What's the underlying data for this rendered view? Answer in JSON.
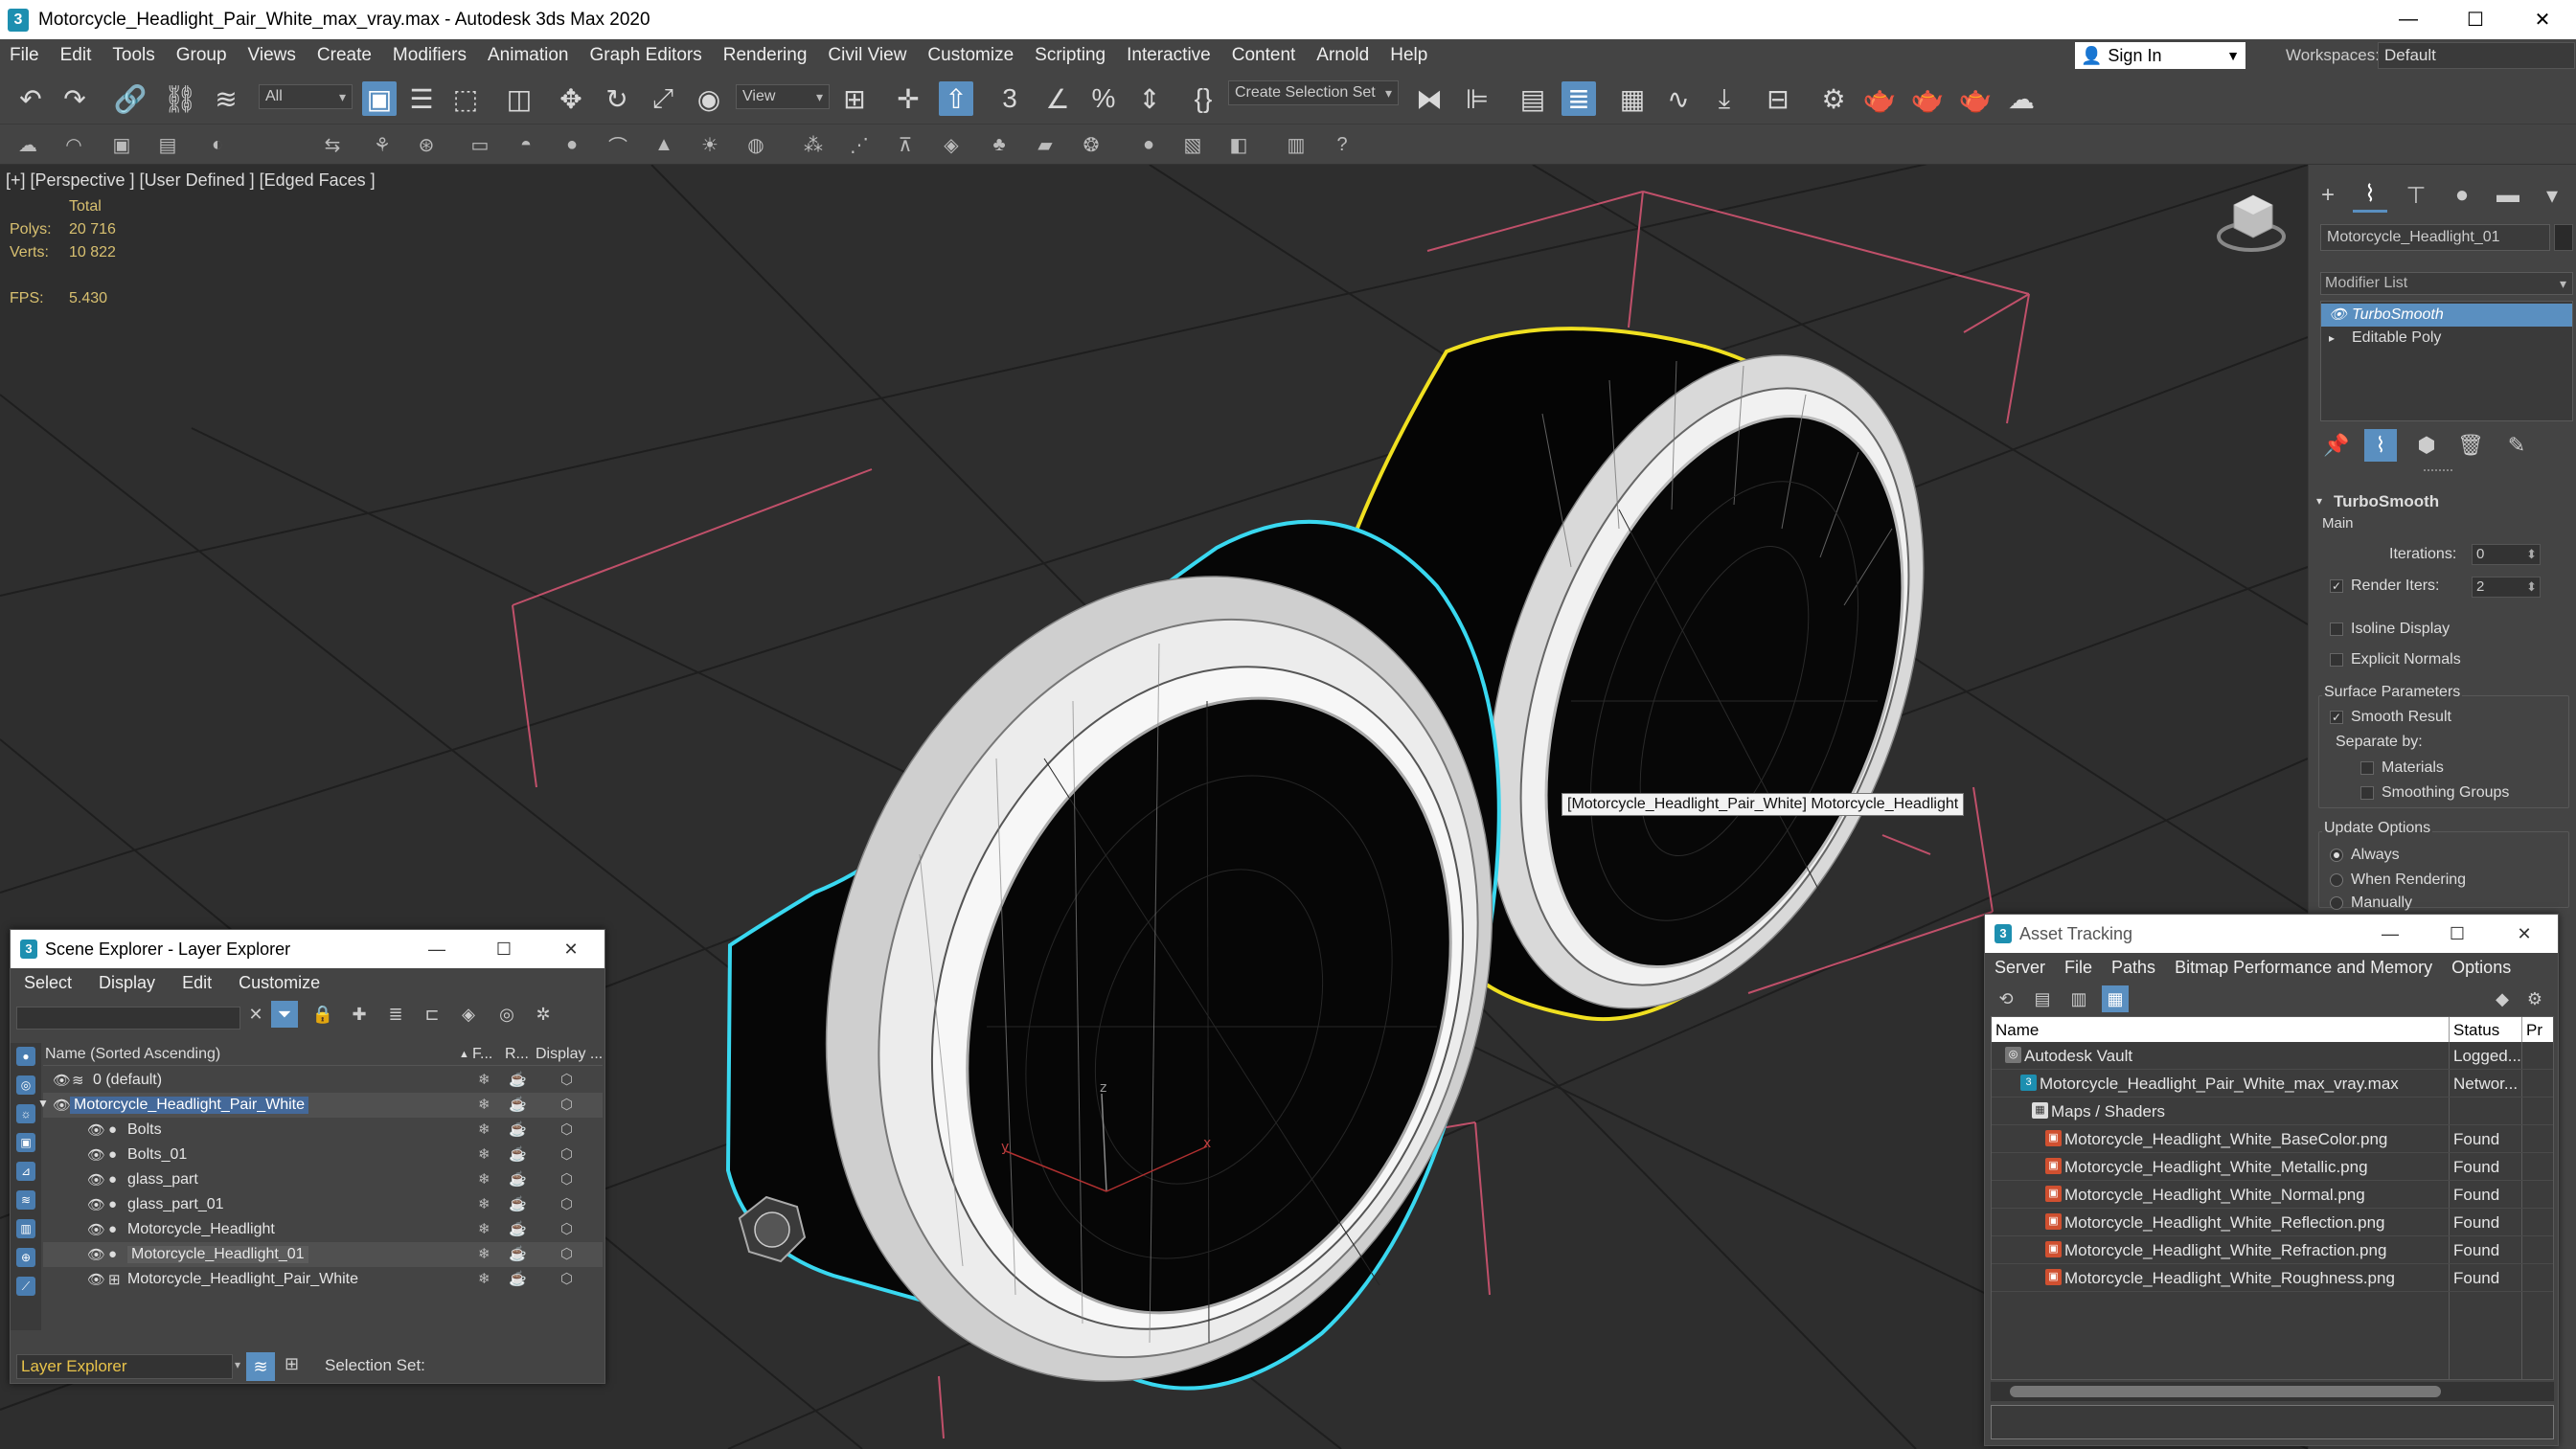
{
  "window": {
    "title": "Motorcycle_Headlight_Pair_White_max_vray.max - Autodesk 3ds Max 2020",
    "app_icon": "3",
    "minimize": "—",
    "maximize": "☐",
    "close": "✕"
  },
  "menu": [
    "File",
    "Edit",
    "Tools",
    "Group",
    "Views",
    "Create",
    "Modifiers",
    "Animation",
    "Graph Editors",
    "Rendering",
    "Civil View",
    "Customize",
    "Scripting",
    "Interactive",
    "Content",
    "Arnold",
    "Help"
  ],
  "signin": {
    "label": "Sign In",
    "icon": "user-icon"
  },
  "workspaces": {
    "label": "Workspaces:",
    "value": "Default"
  },
  "toolbar": {
    "selection_filter": "All",
    "reference_coord": "View",
    "selection_set": "Create Selection Set"
  },
  "viewport": {
    "label": "[+] [Perspective ] [User Defined ] [Edged Faces ]",
    "stats_header": "Total",
    "polys_label": "Polys:",
    "polys_value": "20 716",
    "verts_label": "Verts:",
    "verts_value": "10 822",
    "fps_label": "FPS:",
    "fps_value": "5.430",
    "tooltip": "[Motorcycle_Headlight_Pair_White] Motorcycle_Headlight",
    "axis_z": "z",
    "axis_y": "y",
    "axis_x": "x"
  },
  "command_panel": {
    "object_name": "Motorcycle_Headlight_01",
    "modifier_list": "Modifier List",
    "stack": [
      {
        "label": "TurboSmooth",
        "selected": true
      },
      {
        "label": "Editable Poly",
        "selected": false
      }
    ],
    "rollout_title": "TurboSmooth",
    "main_label": "Main",
    "iterations_label": "Iterations:",
    "iterations_value": "0",
    "render_iters_label": "Render Iters:",
    "render_iters_value": "2",
    "render_iters_checked": true,
    "isoline_label": "Isoline Display",
    "explicit_normals_label": "Explicit Normals",
    "surface_params_label": "Surface Parameters",
    "smooth_result_label": "Smooth Result",
    "separate_by_label": "Separate by:",
    "materials_label": "Materials",
    "smoothing_groups_label": "Smoothing Groups",
    "update_options_label": "Update Options",
    "always_label": "Always",
    "when_rendering_label": "When Rendering",
    "manually_label": "Manually"
  },
  "scene_explorer": {
    "title": "Scene Explorer - Layer Explorer",
    "menu": [
      "Select",
      "Display",
      "Edit",
      "Customize"
    ],
    "columns": {
      "name": "Name (Sorted Ascending)",
      "frozen": "F...",
      "render": "R...",
      "display": "Display ..."
    },
    "rows": [
      {
        "name": "0 (default)",
        "indent": 1,
        "type": "layer"
      },
      {
        "name": "Motorcycle_Headlight_Pair_White",
        "indent": 1,
        "type": "layer-open"
      },
      {
        "name": "Bolts",
        "indent": 2,
        "type": "object"
      },
      {
        "name": "Bolts_01",
        "indent": 2,
        "type": "object"
      },
      {
        "name": "glass_part",
        "indent": 2,
        "type": "object"
      },
      {
        "name": "glass_part_01",
        "indent": 2,
        "type": "object"
      },
      {
        "name": "Motorcycle_Headlight",
        "indent": 2,
        "type": "object"
      },
      {
        "name": "Motorcycle_Headlight_01",
        "indent": 2,
        "type": "object-selected"
      },
      {
        "name": "Motorcycle_Headlight_Pair_White",
        "indent": 2,
        "type": "group"
      }
    ],
    "footer_explorer": "Layer Explorer",
    "selection_set_label": "Selection Set:"
  },
  "asset_tracking": {
    "title": "Asset Tracking",
    "menu": [
      "Server",
      "File",
      "Paths",
      "Bitmap Performance and Memory",
      "Options"
    ],
    "columns": {
      "name": "Name",
      "status": "Status",
      "extra": "Pr"
    },
    "rows": [
      {
        "name": "Autodesk Vault",
        "status": "Logged...",
        "indent": 1,
        "icon": "vault-icon"
      },
      {
        "name": "Motorcycle_Headlight_Pair_White_max_vray.max",
        "status": "Networ...",
        "indent": 2,
        "icon": "max-file-icon"
      },
      {
        "name": "Maps / Shaders",
        "status": "",
        "indent": 3,
        "icon": "folder-icon"
      },
      {
        "name": "Motorcycle_Headlight_White_BaseColor.png",
        "status": "Found",
        "indent": 4,
        "icon": "image-file-icon"
      },
      {
        "name": "Motorcycle_Headlight_White_Metallic.png",
        "status": "Found",
        "indent": 4,
        "icon": "image-file-icon"
      },
      {
        "name": "Motorcycle_Headlight_White_Normal.png",
        "status": "Found",
        "indent": 4,
        "icon": "image-file-icon"
      },
      {
        "name": "Motorcycle_Headlight_White_Reflection.png",
        "status": "Found",
        "indent": 4,
        "icon": "image-file-icon"
      },
      {
        "name": "Motorcycle_Headlight_White_Refraction.png",
        "status": "Found",
        "indent": 4,
        "icon": "image-file-icon"
      },
      {
        "name": "Motorcycle_Headlight_White_Roughness.png",
        "status": "Found",
        "indent": 4,
        "icon": "image-file-icon"
      }
    ]
  },
  "colors": {
    "accent": "#5a8fc0",
    "selection_cyan": "#39d8f0",
    "selection_yellow": "#f0e020",
    "viewport_bg": "#2e2e2e",
    "stats_text": "#d8c070"
  }
}
